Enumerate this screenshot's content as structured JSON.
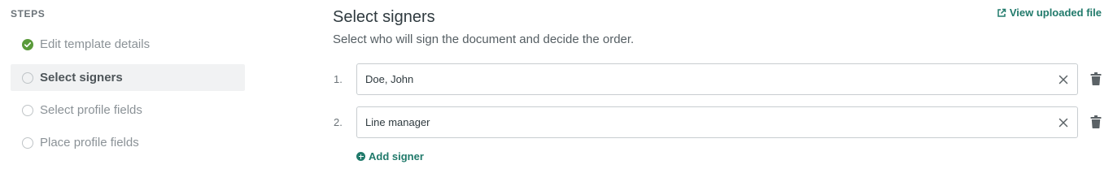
{
  "steps": {
    "heading": "STEPS",
    "items": [
      {
        "label": "Edit template details",
        "state": "complete"
      },
      {
        "label": "Select signers",
        "state": "active"
      },
      {
        "label": "Select profile fields",
        "state": "pending"
      },
      {
        "label": "Place profile fields",
        "state": "pending"
      }
    ]
  },
  "main": {
    "title": "Select signers",
    "subtitle": "Select who will sign the document and decide the order.",
    "view_file_label": "View uploaded file",
    "signers": [
      {
        "number": "1.",
        "value": "Doe, John"
      },
      {
        "number": "2.",
        "value": "Line manager"
      }
    ],
    "add_signer_label": "Add signer"
  },
  "colors": {
    "accent": "#217a6b",
    "complete_check": "#5a9a3a",
    "active_step_bg": "#f1f2f3"
  },
  "icons": {
    "complete": "check-circle-icon",
    "pending": "circle-outline-icon",
    "external": "external-link-icon",
    "clear": "close-icon",
    "delete": "trash-icon",
    "add": "plus-circle-icon"
  }
}
